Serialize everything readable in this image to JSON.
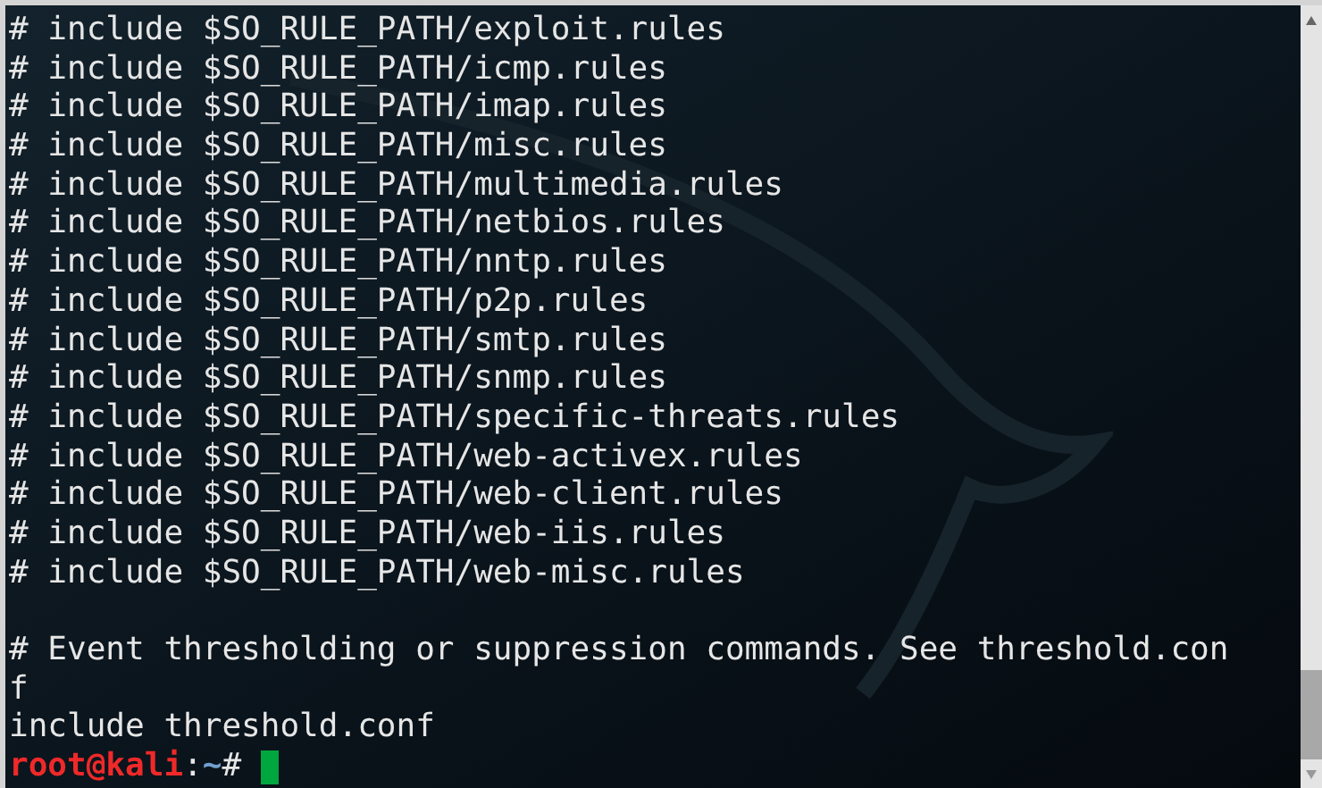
{
  "terminal": {
    "lines": [
      {
        "kind": "text",
        "text": "# include $SO_RULE_PATH/exploit.rules"
      },
      {
        "kind": "text",
        "text": "# include $SO_RULE_PATH/icmp.rules"
      },
      {
        "kind": "text",
        "text": "# include $SO_RULE_PATH/imap.rules"
      },
      {
        "kind": "text",
        "text": "# include $SO_RULE_PATH/misc.rules"
      },
      {
        "kind": "text",
        "text": "# include $SO_RULE_PATH/multimedia.rules"
      },
      {
        "kind": "text",
        "text": "# include $SO_RULE_PATH/netbios.rules"
      },
      {
        "kind": "text",
        "text": "# include $SO_RULE_PATH/nntp.rules"
      },
      {
        "kind": "text",
        "text": "# include $SO_RULE_PATH/p2p.rules"
      },
      {
        "kind": "text",
        "text": "# include $SO_RULE_PATH/smtp.rules"
      },
      {
        "kind": "text",
        "text": "# include $SO_RULE_PATH/snmp.rules"
      },
      {
        "kind": "text",
        "text": "# include $SO_RULE_PATH/specific-threats.rules"
      },
      {
        "kind": "text",
        "text": "# include $SO_RULE_PATH/web-activex.rules"
      },
      {
        "kind": "text",
        "text": "# include $SO_RULE_PATH/web-client.rules"
      },
      {
        "kind": "text",
        "text": "# include $SO_RULE_PATH/web-iis.rules"
      },
      {
        "kind": "text",
        "text": "# include $SO_RULE_PATH/web-misc.rules"
      },
      {
        "kind": "blank"
      },
      {
        "kind": "text",
        "text": "# Event thresholding or suppression commands. See threshold.con"
      },
      {
        "kind": "text",
        "text": "f"
      },
      {
        "kind": "text",
        "text": "include threshold.conf"
      },
      {
        "kind": "prompt",
        "user_host": "root@kali",
        "separator": ":",
        "path": "~",
        "symbol": "#"
      }
    ]
  }
}
